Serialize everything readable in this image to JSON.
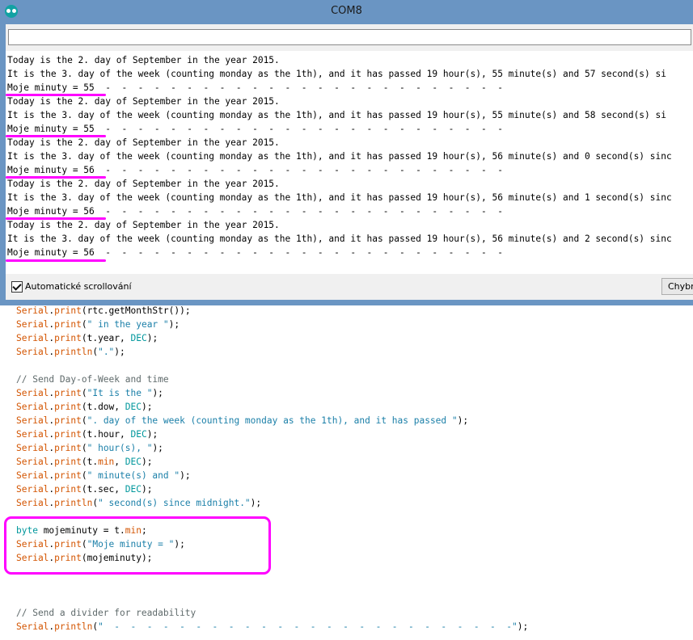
{
  "window": {
    "title": "COM8"
  },
  "serial_monitor": {
    "send_input_value": "",
    "lines": [
      "Today is the 2. day of September in the year 2015.",
      "It is the 3. day of the week (counting monday as the 1th), and it has passed 19 hour(s), 55 minute(s) and 57 second(s) si",
      "Moje minuty = 55  -  -  -  -  -  -  -  -  -  -  -  -  -  -  -  -  -  -  -  -  -  -  -  -  -",
      "Today is the 2. day of September in the year 2015.",
      "It is the 3. day of the week (counting monday as the 1th), and it has passed 19 hour(s), 55 minute(s) and 58 second(s) si",
      "Moje minuty = 55  -  -  -  -  -  -  -  -  -  -  -  -  -  -  -  -  -  -  -  -  -  -  -  -  -",
      "Today is the 2. day of September in the year 2015.",
      "It is the 3. day of the week (counting monday as the 1th), and it has passed 19 hour(s), 56 minute(s) and 0 second(s) sinc",
      "Moje minuty = 56  -  -  -  -  -  -  -  -  -  -  -  -  -  -  -  -  -  -  -  -  -  -  -  -  -",
      "Today is the 2. day of September in the year 2015.",
      "It is the 3. day of the week (counting monday as the 1th), and it has passed 19 hour(s), 56 minute(s) and 1 second(s) sinc",
      "Moje minuty = 56  -  -  -  -  -  -  -  -  -  -  -  -  -  -  -  -  -  -  -  -  -  -  -  -  -",
      "Today is the 2. day of September in the year 2015.",
      "It is the 3. day of the week (counting monday as the 1th), and it has passed 19 hour(s), 56 minute(s) and 2 second(s) sinc",
      "Moje minuty = 56  -  -  -  -  -  -  -  -  -  -  -  -  -  -  -  -  -  -  -  -  -  -  -  -  -"
    ],
    "autoscroll_label": "Automatické scrollování",
    "autoscroll_checked": true,
    "line_ending_selected": "Chybný konec řádku"
  },
  "code": {
    "serial": "Serial",
    "print": "print",
    "println": "println",
    "l1_arg": "(rtc.getMonthStr());",
    "l2_str": "\" in the year \"",
    "l3_a": "(t.year, ",
    "dec": "DEC",
    "close": ");",
    "open": "(",
    "l4_str": "\".\"",
    "comment_dow": "// Send Day-of-Week and time",
    "s_itis": "\"It is the \"",
    "a_dow": "(t.dow, ",
    "s_day": "\". day of the week (counting monday as the 1th), and it has passed \"",
    "a_hour": "(t.hour, ",
    "s_hour": "\" hour(s), \"",
    "a_min_1": "(t.",
    "min": "min",
    "a_min_2": ", ",
    "s_minute": "\" minute(s) and \"",
    "a_sec": "(t.sec, ",
    "s_second": "\" second(s) since midnight.\"",
    "byte": "byte",
    "assign": " mojeminuty = t.",
    "semi": ";",
    "s_moje": "\"Moje minuty = \"",
    "a_moje": "(mojeminuty);",
    "comment_div": "// Send a divider for readability",
    "s_div": "\"  -  -  -  -  -  -  -  -  -  -  -  -  -  -  -  -  -  -  -  -  -  -  -  -  -\""
  },
  "colors": {
    "titlebar": "#6a95c3",
    "highlight": "#ff00ff",
    "keyword": "#d35400",
    "type": "#00979c"
  }
}
